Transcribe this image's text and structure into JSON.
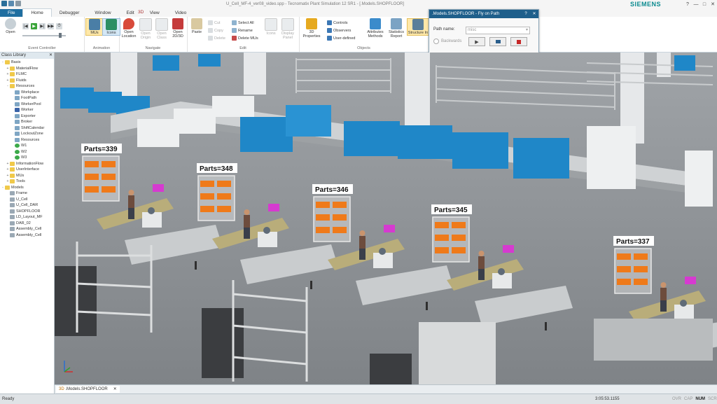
{
  "window": {
    "title": "U_Cell_MF-4_ver08_video.spp - Tecnomatix Plant Simulation 12 SR1 - [.Models.SHOPFLOOR]",
    "brand": "SIEMENS",
    "controls": [
      "?",
      "—",
      "□",
      "✕"
    ]
  },
  "ribbon_tabs": [
    {
      "label": "File"
    },
    {
      "label": "Home"
    },
    {
      "label": "Debugger"
    },
    {
      "label": "Window"
    },
    {
      "label": "Edit"
    },
    {
      "label": "View"
    },
    {
      "label": "Video"
    }
  ],
  "context_tab": "3D",
  "ribbon": {
    "event_controller": {
      "label": "Event Controller",
      "open_label": "Open",
      "controls": [
        "reset",
        "start-stop",
        "step",
        "fast-forward",
        "run-until",
        "slider"
      ]
    },
    "animation": {
      "label": "Animation",
      "mus": "MUs",
      "icons": "Icons"
    },
    "navigate": {
      "label": "Navigate",
      "buttons": [
        "Open Location",
        "Open Origin",
        "Open Class",
        "Open 2D/3D"
      ]
    },
    "edit": {
      "label": "Edit",
      "paste": "Paste",
      "cut": "Cut",
      "copy": "Copy",
      "delete": "Delete",
      "select_all": "Select All",
      "rename": "Rename",
      "delete_mus": "Delete MUs",
      "icons": "Icons",
      "display_panel": "Display Panel"
    },
    "objects": {
      "label": "Objects",
      "properties": "3D Properties",
      "controls": "Controls",
      "observers": "Observers",
      "user_defined": "User-defined",
      "attributes_methods": "Attributes Methods",
      "statistics_report": "Statistics Report",
      "structure": "Structure In"
    }
  },
  "fly_dialog": {
    "title": ".Models.SHOPFLOOR - Fly on Path",
    "path_label": "Path name:",
    "path_value": "misc",
    "backwards": "Backwards"
  },
  "class_library": {
    "header": "Class Library",
    "items": [
      {
        "label": "Basis",
        "level": 0,
        "expander": "-",
        "kind": "folder"
      },
      {
        "label": "MaterialFlow",
        "level": 1,
        "expander": "+",
        "kind": "folder"
      },
      {
        "label": "FLMC",
        "level": 1,
        "expander": "+",
        "kind": "folder"
      },
      {
        "label": "Fluids",
        "level": 1,
        "expander": "+",
        "kind": "folder"
      },
      {
        "label": "Resources",
        "level": 1,
        "expander": "-",
        "kind": "folder"
      },
      {
        "label": "Workplace",
        "level": 2,
        "expander": "",
        "kind": "obj"
      },
      {
        "label": "FootPath",
        "level": 2,
        "expander": "",
        "kind": "obj"
      },
      {
        "label": "WorkerPool",
        "level": 2,
        "expander": "",
        "kind": "obj"
      },
      {
        "label": "Worker",
        "level": 2,
        "expander": "",
        "kind": "worker"
      },
      {
        "label": "Exporter",
        "level": 2,
        "expander": "",
        "kind": "obj"
      },
      {
        "label": "Broker",
        "level": 2,
        "expander": "",
        "kind": "obj"
      },
      {
        "label": "ShiftCalendar",
        "level": 2,
        "expander": "",
        "kind": "obj"
      },
      {
        "label": "LockoutZone",
        "level": 2,
        "expander": "",
        "kind": "obj"
      },
      {
        "label": "Resources",
        "level": 2,
        "expander": "",
        "kind": "obj"
      },
      {
        "label": "W1",
        "level": 2,
        "expander": "",
        "kind": "green"
      },
      {
        "label": "W2",
        "level": 2,
        "expander": "",
        "kind": "green"
      },
      {
        "label": "W3",
        "level": 2,
        "expander": "",
        "kind": "green"
      },
      {
        "label": "InformationFlow",
        "level": 1,
        "expander": "+",
        "kind": "folder"
      },
      {
        "label": "UserInterface",
        "level": 1,
        "expander": "+",
        "kind": "folder"
      },
      {
        "label": "MUs",
        "level": 1,
        "expander": "+",
        "kind": "folder"
      },
      {
        "label": "Tools",
        "level": 1,
        "expander": "+",
        "kind": "folder"
      },
      {
        "label": "Models",
        "level": 0,
        "expander": "-",
        "kind": "folder"
      },
      {
        "label": "Frame",
        "level": 1,
        "expander": "",
        "kind": "frame"
      },
      {
        "label": "U_Cell",
        "level": 1,
        "expander": "",
        "kind": "frame"
      },
      {
        "label": "U_Cell_DAR",
        "level": 1,
        "expander": "",
        "kind": "frame"
      },
      {
        "label": "SHOPFLOOR",
        "level": 1,
        "expander": "",
        "kind": "frame"
      },
      {
        "label": "LD_Layout_MF",
        "level": 1,
        "expander": "",
        "kind": "frame"
      },
      {
        "label": "DAR_02",
        "level": 1,
        "expander": "",
        "kind": "frame"
      },
      {
        "label": "Assembly_Cell",
        "level": 1,
        "expander": "",
        "kind": "frame"
      },
      {
        "label": "Assembly_Cell",
        "level": 1,
        "expander": "",
        "kind": "frame"
      }
    ]
  },
  "scene": {
    "stations": [
      {
        "label": "Parts=339"
      },
      {
        "label": "Parts=348"
      },
      {
        "label": "Parts=346"
      },
      {
        "label": "Parts=345"
      },
      {
        "label": "Parts=337"
      }
    ],
    "colors": {
      "floor": "#8e9296",
      "machine": "#1f87c8",
      "conveyor": "#c9ccce",
      "table": "#b9ad7a",
      "bin": "#ef7a1a",
      "box": "#d63ad0"
    }
  },
  "document_tab": {
    "prefix": "3D",
    "label": ".Models.SHOPFLOOR",
    "close": "✕"
  },
  "status": {
    "ready": "Ready",
    "time": "3:05:53.1155",
    "keys": [
      {
        "label": "OVR",
        "on": false
      },
      {
        "label": "CAP",
        "on": false
      },
      {
        "label": "NUM",
        "on": true
      },
      {
        "label": "SCRL",
        "on": false
      }
    ]
  }
}
